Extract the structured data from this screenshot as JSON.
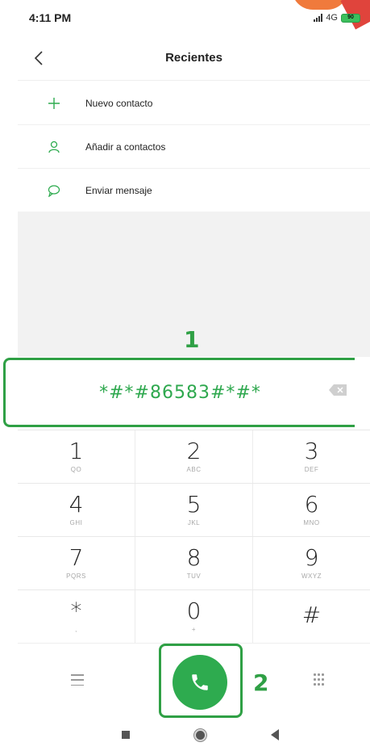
{
  "status_bar": {
    "time": "4:11 PM",
    "network": "4G",
    "battery": "90"
  },
  "header": {
    "title": "Recientes"
  },
  "menu": {
    "items": [
      {
        "label": "Nuevo contacto",
        "icon": "plus-icon"
      },
      {
        "label": "Añadir a contactos",
        "icon": "person-icon"
      },
      {
        "label": "Enviar mensaje",
        "icon": "message-icon"
      }
    ]
  },
  "dialer": {
    "number": "*#*#86583#*#*"
  },
  "keypad": {
    "rows": [
      [
        {
          "digit": "1",
          "letters": "QO"
        },
        {
          "digit": "2",
          "letters": "ABC"
        },
        {
          "digit": "3",
          "letters": "DEF"
        }
      ],
      [
        {
          "digit": "4",
          "letters": "GHI"
        },
        {
          "digit": "5",
          "letters": "JKL"
        },
        {
          "digit": "6",
          "letters": "MNO"
        }
      ],
      [
        {
          "digit": "7",
          "letters": "PQRS"
        },
        {
          "digit": "8",
          "letters": "TUV"
        },
        {
          "digit": "9",
          "letters": "WXYZ"
        }
      ],
      [
        {
          "digit": "*",
          "letters": ","
        },
        {
          "digit": "0",
          "letters": "+"
        },
        {
          "digit": "#",
          "letters": ""
        }
      ]
    ]
  },
  "annotations": {
    "step1": "1",
    "step2": "2"
  },
  "colors": {
    "accent": "#2eab4f",
    "annotation": "#2fa045"
  }
}
